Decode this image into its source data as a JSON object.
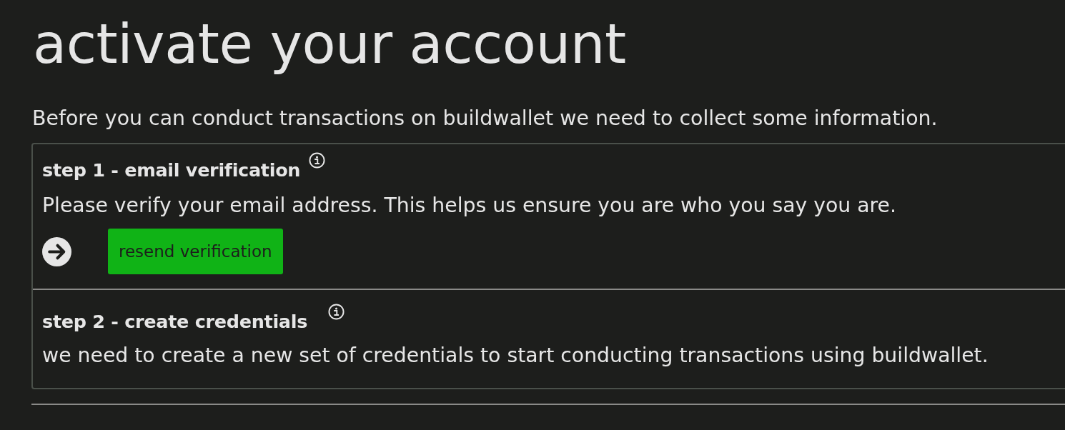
{
  "page": {
    "title": "activate your account",
    "intro": "Before you can conduct transactions on buildwallet we need to collect some information."
  },
  "steps": [
    {
      "title": "step 1 - email verification",
      "description": "Please verify your email address. This helps us ensure you are who you say you are.",
      "current": true,
      "action": {
        "label": "resend verification"
      }
    },
    {
      "title": "step 2 - create credentials",
      "description": "we need to create a new set of credentials to start conducting transactions using buildwallet.",
      "current": false
    }
  ]
}
